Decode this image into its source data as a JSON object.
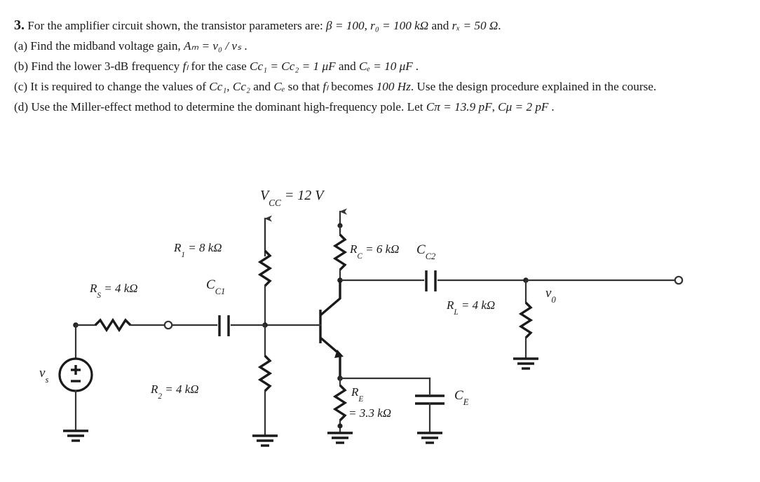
{
  "problem": {
    "number": "3.",
    "intro_text": "For the amplifier circuit shown, the transistor parameters are:",
    "intro_params": {
      "beta": "β = 100",
      "ro": "r₀ = 100 kΩ",
      "rx": "rₓ = 50 Ω"
    },
    "parts": [
      {
        "tag": "(a)",
        "text": "Find the midband voltage gain,",
        "math": "Aₘ = v₀ / vₛ ."
      },
      {
        "tag": "(b)",
        "text": "Find the lower 3-dB frequency",
        "math_1": "fₗ",
        "text_2": "for the case",
        "math_2": "Cс₁ = Cс₂ = 1 μF",
        "text_3": "and",
        "math_3": "Cₑ = 10 μF ."
      },
      {
        "tag": "(c)",
        "text": "It is required to change the values of",
        "math_1": "Cс₁, Cс₂",
        "text_2": "and",
        "math_2": "Cₑ",
        "text_3": "so that",
        "math_3": "fₗ",
        "text_4": "becomes",
        "math_4": "100 Hz",
        "text_5": ". Use the design procedure explained in the course."
      },
      {
        "tag": "(d)",
        "text": "Use the Miller-effect method to determine the dominant high-frequency pole. Let",
        "math_1": "Cπ = 13.9 pF",
        "math_2": "Cμ = 2 pF ."
      }
    ]
  },
  "circuit": {
    "title": "common-emitter BJT amplifier",
    "labels": {
      "vcc": "V",
      "vcc_sub": "CC",
      "vcc_value": "= 12  V",
      "r1": "R",
      "r1_sub": "1",
      "r1_value": "= 8  kΩ",
      "r2": "R",
      "r2_sub": "2",
      "r2_value": "= 4  kΩ",
      "rc": "R",
      "rc_sub": "C",
      "rc_value": "= 6  kΩ",
      "re": "R",
      "re_sub": "E",
      "re_value": "= 3.3 kΩ",
      "rl": "R",
      "rl_sub": "L",
      "rl_value": "= 4  kΩ",
      "rs": "R",
      "rs_sub": "S",
      "rs_value": "= 4  kΩ",
      "cc1": "C",
      "cc1_sub": "C1",
      "cc2": "C",
      "cc2_sub": "C2",
      "ce": "C",
      "ce_sub": "E",
      "vs": "v",
      "vs_sub": "s",
      "vo": "v",
      "vo_sub": "0"
    },
    "components": {
      "source": "independent-voltage-source",
      "transistor": "npn-bjt",
      "grounds": 5,
      "capacitors": 3,
      "resistors": 6
    },
    "colors": {
      "wire": "#333333",
      "text": "#1a1a1a",
      "background": "#ffffff"
    }
  }
}
